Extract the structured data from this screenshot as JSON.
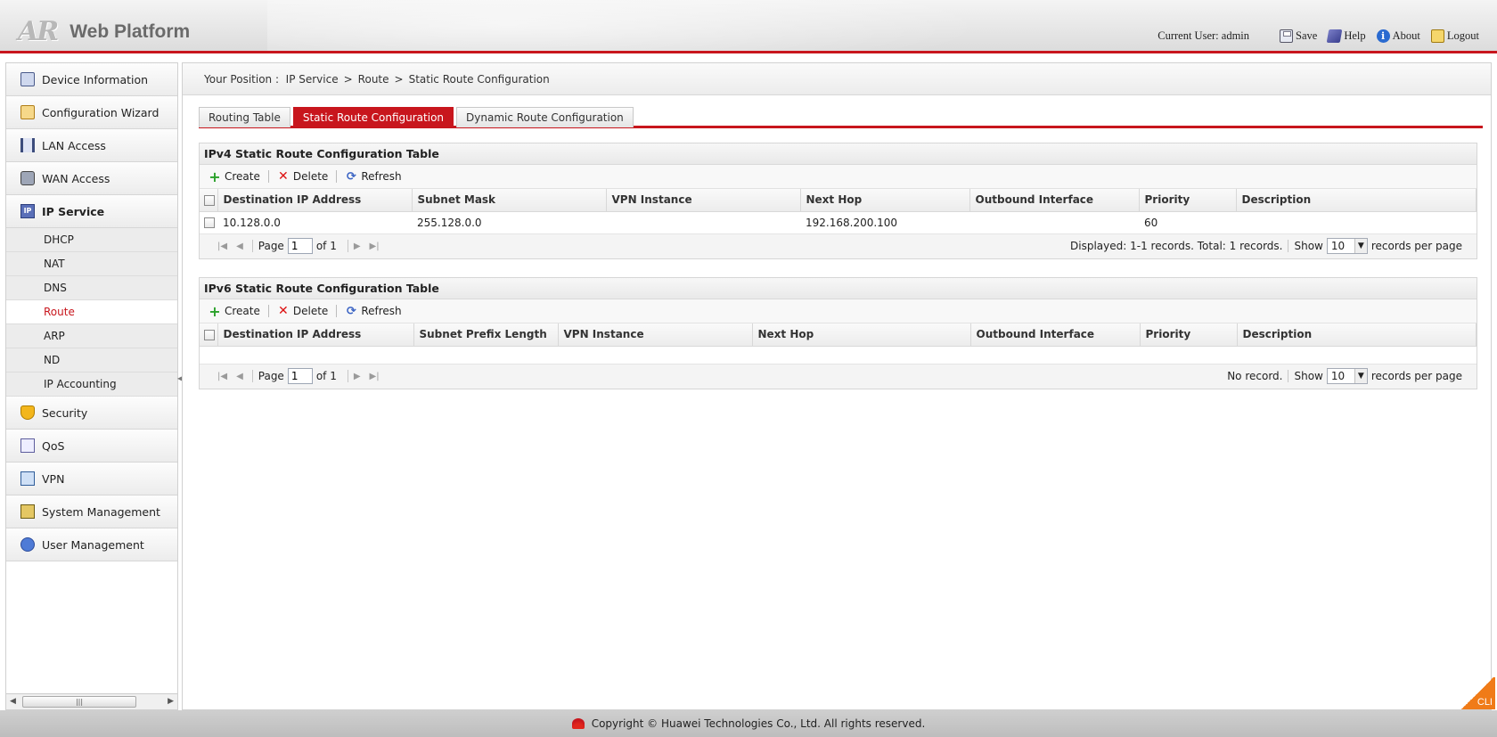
{
  "header": {
    "logo_mark": "AR",
    "logo_text": "Web Platform",
    "current_user_label": "Current User:",
    "current_user": "admin",
    "save": "Save",
    "help": "Help",
    "about": "About",
    "logout": "Logout"
  },
  "sidebar": {
    "items": [
      {
        "label": "Device Information"
      },
      {
        "label": "Configuration Wizard"
      },
      {
        "label": "LAN Access"
      },
      {
        "label": "WAN Access"
      },
      {
        "label": "IP Service"
      },
      {
        "label": "Security"
      },
      {
        "label": "QoS"
      },
      {
        "label": "VPN"
      },
      {
        "label": "System Management"
      },
      {
        "label": "User Management"
      }
    ],
    "sub_items": [
      {
        "label": "DHCP"
      },
      {
        "label": "NAT"
      },
      {
        "label": "DNS"
      },
      {
        "label": "Route"
      },
      {
        "label": "ARP"
      },
      {
        "label": "ND"
      },
      {
        "label": "IP Accounting"
      }
    ],
    "active_item": "IP Service",
    "active_sub_item": "Route"
  },
  "breadcrumb": {
    "label": "Your Position :",
    "parts": [
      "IP Service",
      "Route",
      "Static Route Configuration"
    ]
  },
  "tabs": [
    {
      "label": "Routing Table"
    },
    {
      "label": "Static Route Configuration"
    },
    {
      "label": "Dynamic Route Configuration"
    }
  ],
  "active_tab": "Static Route Configuration",
  "toolbar": {
    "create": "Create",
    "delete": "Delete",
    "refresh": "Refresh"
  },
  "ipv4": {
    "title": "IPv4 Static Route Configuration Table",
    "columns": [
      "Destination IP Address",
      "Subnet Mask",
      "VPN Instance",
      "Next Hop",
      "Outbound Interface",
      "Priority",
      "Description"
    ],
    "rows": [
      {
        "dest": "10.128.0.0",
        "mask": "255.128.0.0",
        "vpn": "",
        "next_hop": "192.168.200.100",
        "iface": "",
        "priority": "60",
        "desc": ""
      }
    ],
    "pager": {
      "page_label": "Page",
      "page": "1",
      "of": "of 1",
      "status": "Displayed: 1-1 records. Total: 1 records.",
      "show": "Show",
      "per_page": "10",
      "per_page_label": "records per page"
    }
  },
  "ipv6": {
    "title": "IPv6 Static Route Configuration Table",
    "columns": [
      "Destination IP Address",
      "Subnet Prefix Length",
      "VPN Instance",
      "Next Hop",
      "Outbound Interface",
      "Priority",
      "Description"
    ],
    "rows": [],
    "pager": {
      "page_label": "Page",
      "page": "1",
      "of": "of 1",
      "status": "No record.",
      "show": "Show",
      "per_page": "10",
      "per_page_label": "records per page"
    }
  },
  "footer": {
    "copyright": "Copyright © Huawei Technologies Co., Ltd. All rights reserved."
  },
  "cli": "CLI",
  "colors": {
    "accent": "#c8161d",
    "cli": "#f07b18"
  }
}
